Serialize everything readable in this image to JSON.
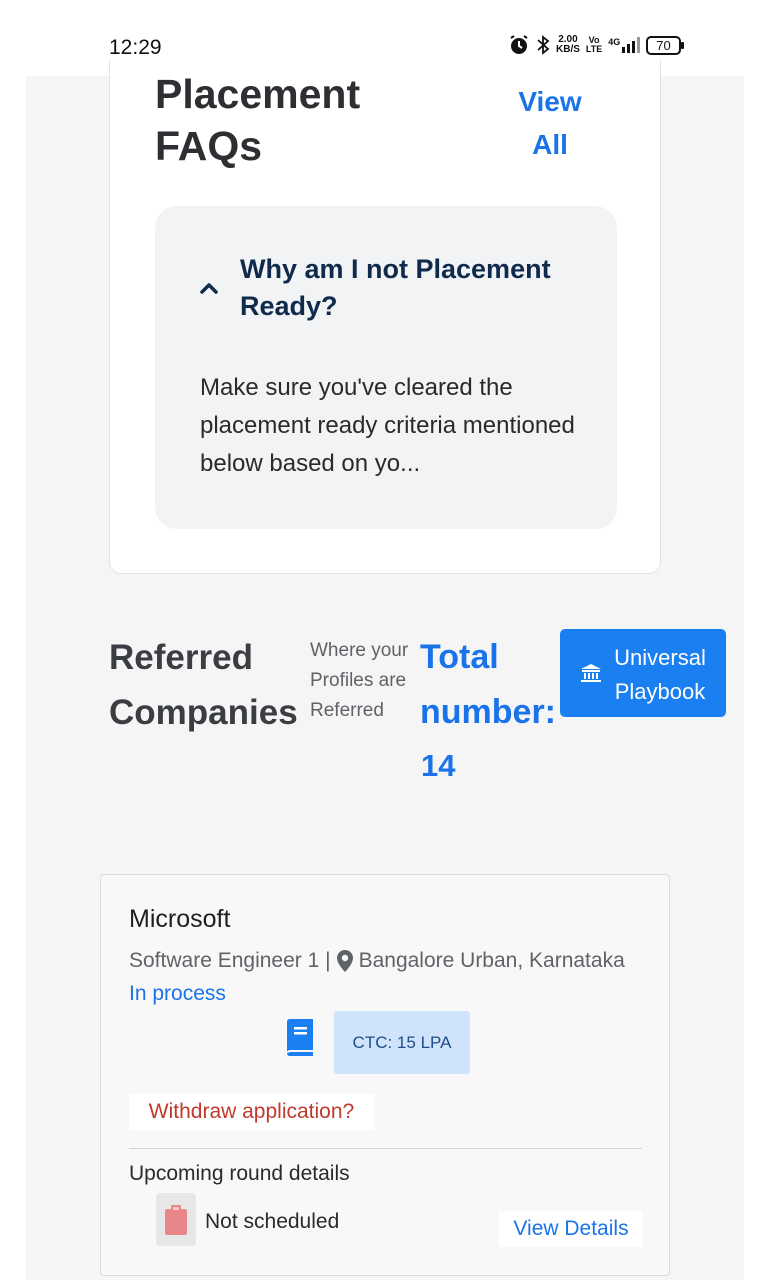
{
  "status_bar": {
    "time": "12:29",
    "speed_value": "2.00",
    "speed_unit": "KB/S",
    "volte": "Vo",
    "lte": "LTE",
    "network": "4G",
    "battery": "70"
  },
  "faq": {
    "title": "Placement FAQs",
    "view_all": "View All",
    "items": [
      {
        "question": "Why am I not Placement Ready?",
        "answer": "Make sure you've cleared the placement ready criteria mentioned below based on yo...",
        "expanded": true
      }
    ]
  },
  "referred": {
    "title": "Referred Companies",
    "subtitle": "Where your Profiles are Referred",
    "total_label": "Total number:",
    "total_value": "14",
    "playbook_button": "Universal Playbook"
  },
  "companies": [
    {
      "name": "Microsoft",
      "role": "Software Engineer 1 |",
      "location": "Bangalore Urban, Karnataka",
      "status": "In process",
      "ctc": "CTC: 15 LPA",
      "withdraw": "Withdraw application?",
      "upcoming_heading": "Upcoming round details",
      "round_status": "Not scheduled",
      "view_details": "View Details"
    }
  ],
  "colors": {
    "accent": "#1a73e8",
    "button": "#1a7ff0",
    "danger": "#c0392b",
    "chip": "#cfe3fb"
  },
  "icons": {
    "alarm": "alarm-icon",
    "bluetooth": "bluetooth-icon",
    "signal": "signal-icon",
    "battery": "battery-icon",
    "chevron": "chevron-up-icon",
    "bank": "bank-icon",
    "pin": "location-pin-icon",
    "book": "book-icon",
    "clipboard": "clipboard-icon"
  }
}
